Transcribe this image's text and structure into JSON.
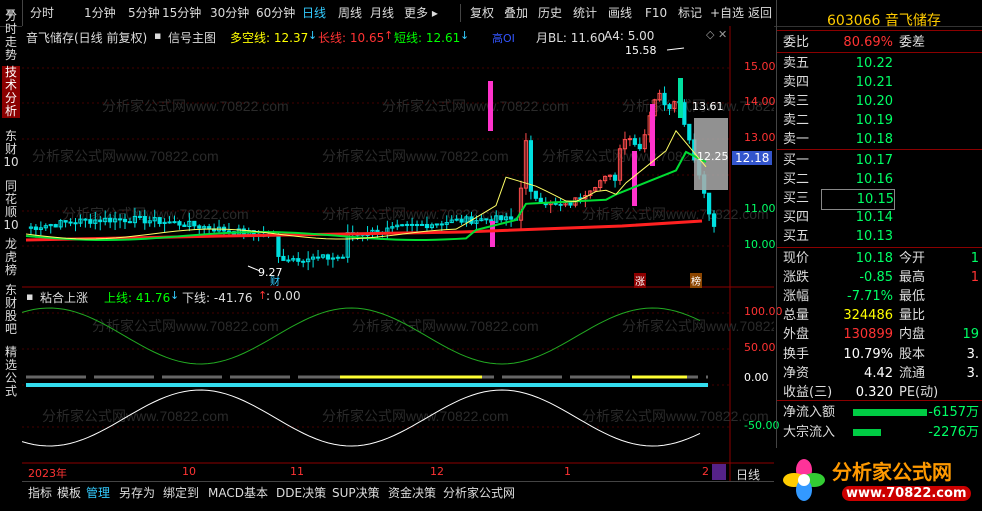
{
  "toolbar": {
    "left_items": [
      "分时",
      "1分钟",
      "5分钟",
      "15分钟",
      "30分钟",
      "60分钟",
      "日线",
      "周线",
      "月线",
      "更多"
    ],
    "selected": "日线",
    "right_items": [
      "复权",
      "叠加",
      "历史",
      "统计",
      "画线",
      "F10",
      "标记",
      "+自选",
      "返回"
    ]
  },
  "left_tabs": [
    "分时走势",
    "技术分析",
    "东财10",
    "同花顺10",
    "龙虎榜",
    "东财股吧",
    "精选公式"
  ],
  "stock": {
    "code": "603066",
    "name": "音飞储存"
  },
  "chart_header": {
    "title": "音飞储存(日线 前复权)",
    "indicator": "信号主图",
    "duo_label": "多空线: 12.37",
    "chang_label": "长线: 10.65",
    "duan_label": "短线: 12.61",
    "pc_label": "月BL: 11.60",
    "a4_label": "A4: 5.00"
  },
  "price_axis": [
    "15.00",
    "14.00",
    "13.00",
    "12.00",
    "11.00",
    "10.00"
  ],
  "price_tag": "12.18",
  "annotations": {
    "high": "15.58",
    "mid1": "13.61",
    "mid2": "12.25",
    "low": "9.27",
    "cai": "财",
    "zhang": "涨",
    "bang": "榜"
  },
  "sub_header": {
    "title": "粘合上涨",
    "up_label": "上线: 41.76",
    "down_label": "下线: -41.76",
    "zero_label": "0.00"
  },
  "sub_axis": [
    "100.00",
    "50.00",
    "0.00",
    "-50.00"
  ],
  "time_axis": [
    "2023年",
    "10",
    "11",
    "12",
    "1",
    "2"
  ],
  "period_label": "日线",
  "bottom_tabs": [
    "指标",
    "模板",
    "管理",
    "另存为",
    "绑定到",
    "MACD基本",
    "DDE决策",
    "SUP决策",
    "资金决策",
    "分析家公式网"
  ],
  "bottom_selected": "管理",
  "watermark": "分析家公式网www.70822.com",
  "quote": {
    "ratio": {
      "k": "委比",
      "v": "80.69%",
      "k2": "委差"
    },
    "sells": [
      {
        "k": "卖五",
        "v": "10.22"
      },
      {
        "k": "卖四",
        "v": "10.21"
      },
      {
        "k": "卖三",
        "v": "10.20"
      },
      {
        "k": "卖二",
        "v": "10.19"
      },
      {
        "k": "卖一",
        "v": "10.18"
      }
    ],
    "buys": [
      {
        "k": "买一",
        "v": "10.17"
      },
      {
        "k": "买二",
        "v": "10.16"
      },
      {
        "k": "买三",
        "v": "10.15"
      },
      {
        "k": "买四",
        "v": "10.14"
      },
      {
        "k": "买五",
        "v": "10.13"
      }
    ],
    "stats": [
      {
        "k": "现价",
        "v": "10.18",
        "k2": "今开",
        "v2": "1"
      },
      {
        "k": "涨跌",
        "v": "-0.85",
        "k2": "最高",
        "v2": "1"
      },
      {
        "k": "涨幅",
        "v": "-7.71%",
        "k2": "最低",
        "v2": ""
      },
      {
        "k": "总量",
        "v": "324486",
        "k2": "量比",
        "v2": ""
      },
      {
        "k": "外盘",
        "v": "130899",
        "k2": "内盘",
        "v2": "19"
      },
      {
        "k": "换手",
        "v": "10.79%",
        "k2": "股本",
        "v2": "3."
      },
      {
        "k": "净资",
        "v": "4.42",
        "k2": "流通",
        "v2": "3."
      },
      {
        "k": "收益(三)",
        "v": "0.320",
        "k2": "PE(动)",
        "v2": ""
      }
    ],
    "flows": [
      {
        "k": "净流入额",
        "v": "-6157万"
      },
      {
        "k": "大宗流入",
        "v": "-2276万"
      }
    ]
  },
  "logo": {
    "name": "分析家公式网",
    "url": "www.70822.com"
  },
  "colors": {
    "up": "#ff3333",
    "down": "#00e0e0",
    "green": "#00ff00",
    "yellow": "#ffff00",
    "white": "#ffffff",
    "cyan": "#33ccff"
  }
}
